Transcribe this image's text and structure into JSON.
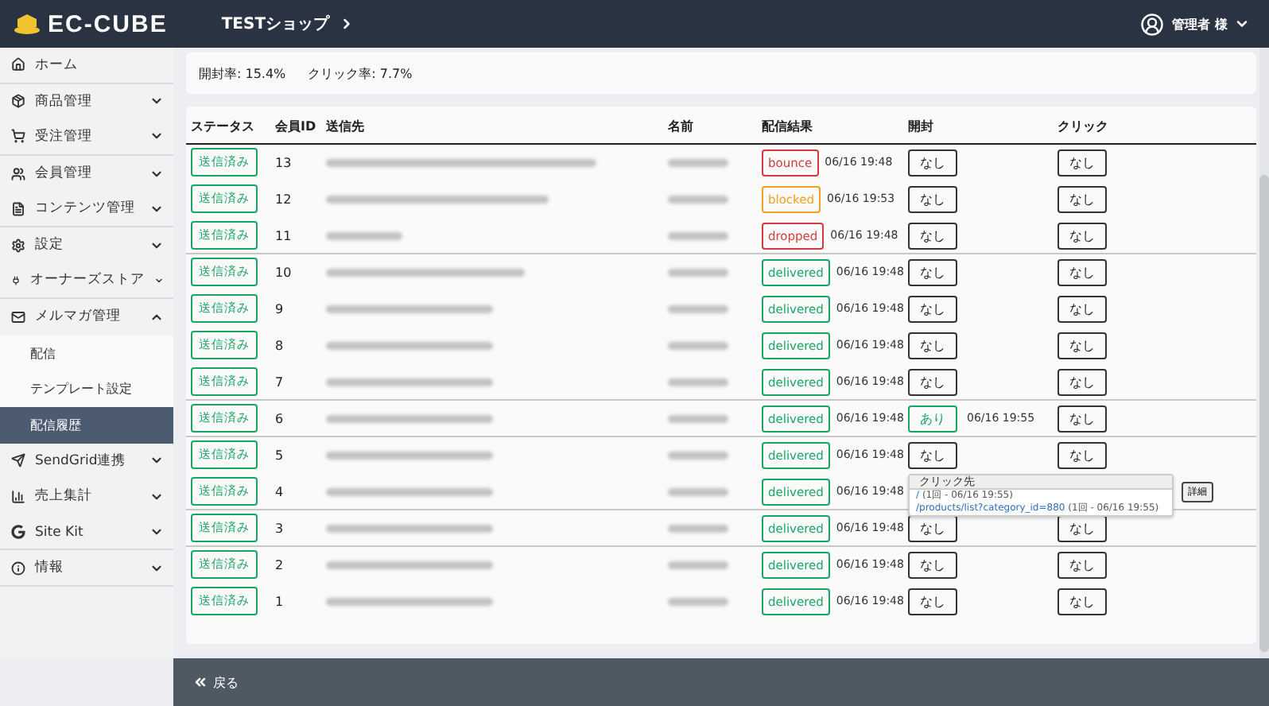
{
  "header": {
    "logo": "EC-CUBE",
    "shop": "TESTショップ",
    "user": "管理者 様"
  },
  "sidebar": {
    "items": [
      {
        "label": "ホーム",
        "expandable": false,
        "expanded": false
      },
      {
        "label": "商品管理",
        "expandable": true,
        "expanded": false
      },
      {
        "label": "受注管理",
        "expandable": true,
        "expanded": false
      },
      {
        "label": "会員管理",
        "expandable": true,
        "expanded": false
      },
      {
        "label": "コンテンツ管理",
        "expandable": true,
        "expanded": false
      },
      {
        "label": "設定",
        "expandable": true,
        "expanded": false
      },
      {
        "label": "オーナーズストア",
        "expandable": true,
        "expanded": false
      },
      {
        "label": "メルマガ管理",
        "expandable": true,
        "expanded": true,
        "children": [
          {
            "label": "配信",
            "selected": false
          },
          {
            "label": "テンプレート設定",
            "selected": false
          },
          {
            "label": "配信履歴",
            "selected": true
          }
        ]
      },
      {
        "label": "SendGrid連携",
        "expandable": true,
        "expanded": false
      },
      {
        "label": "売上集計",
        "expandable": true,
        "expanded": false
      },
      {
        "label": "Site Kit",
        "expandable": true,
        "expanded": false
      },
      {
        "label": "情報",
        "expandable": true,
        "expanded": false
      }
    ]
  },
  "stats": [
    "開封率: 15.4%",
    "クリック率: 7.7%"
  ],
  "table": {
    "columns": [
      "ステータス",
      "会員ID",
      "送信先",
      "名前",
      "配信結果",
      "開封",
      "クリック"
    ],
    "rows": [
      {
        "status": "送信済み",
        "id": "13",
        "result": {
          "label": "bounce",
          "color": "#d33a3a",
          "time": "06/16 19:48"
        },
        "open": {
          "label": "なし",
          "opened": false
        },
        "click": {
          "label": "なし"
        }
      },
      {
        "status": "送信済み",
        "id": "12",
        "result": {
          "label": "blocked",
          "color": "#f0a020",
          "time": "06/16 19:53"
        },
        "open": {
          "label": "なし",
          "opened": false
        },
        "click": {
          "label": "なし"
        }
      },
      {
        "status": "送信済み",
        "id": "11",
        "result": {
          "label": "dropped",
          "color": "#d33a3a",
          "time": "06/16 19:48"
        },
        "open": {
          "label": "なし",
          "opened": false
        },
        "click": {
          "label": "なし"
        }
      },
      {
        "status": "送信済み",
        "id": "10",
        "result": {
          "label": "delivered",
          "color": "#19a463",
          "time": "06/16 19:48"
        },
        "open": {
          "label": "なし",
          "opened": false
        },
        "click": {
          "label": "なし"
        }
      },
      {
        "status": "送信済み",
        "id": "9",
        "result": {
          "label": "delivered",
          "color": "#19a463",
          "time": "06/16 19:48"
        },
        "open": {
          "label": "なし",
          "opened": false
        },
        "click": {
          "label": "なし"
        }
      },
      {
        "status": "送信済み",
        "id": "8",
        "result": {
          "label": "delivered",
          "color": "#19a463",
          "time": "06/16 19:48"
        },
        "open": {
          "label": "なし",
          "opened": false
        },
        "click": {
          "label": "なし"
        }
      },
      {
        "status": "送信済み",
        "id": "7",
        "result": {
          "label": "delivered",
          "color": "#19a463",
          "time": "06/16 19:48"
        },
        "open": {
          "label": "なし",
          "opened": false
        },
        "click": {
          "label": "なし"
        }
      },
      {
        "status": "送信済み",
        "id": "6",
        "result": {
          "label": "delivered",
          "color": "#19a463",
          "time": "06/16 19:48"
        },
        "open": {
          "label": "あり",
          "opened": true,
          "time": "06/16 19:55"
        },
        "click": {
          "label": "なし"
        }
      },
      {
        "status": "送信済み",
        "id": "5",
        "result": {
          "label": "delivered",
          "color": "#19a463",
          "time": "06/16 19:48"
        },
        "open": {
          "label": "なし",
          "opened": false
        },
        "click": {
          "label": "なし"
        }
      },
      {
        "status": "送信済み",
        "id": "4",
        "result": {
          "label": "delivered",
          "color": "#19a463",
          "time": "06/16 19:48"
        },
        "popup": {
          "title": "クリック先",
          "links": [
            {
              "url": "/",
              "note": "(1回 - 06/16 19:55)"
            },
            {
              "url": "/products/list?category_id=880",
              "note": "(1回 - 06/16 19:55)"
            }
          ]
        },
        "click": {
          "detail": "詳細"
        }
      },
      {
        "status": "送信済み",
        "id": "3",
        "result": {
          "label": "delivered",
          "color": "#19a463",
          "time": "06/16 19:48"
        },
        "open": {
          "label": "なし",
          "opened": false
        },
        "click": {
          "label": "なし"
        }
      },
      {
        "status": "送信済み",
        "id": "2",
        "result": {
          "label": "delivered",
          "color": "#19a463",
          "time": "06/16 19:48"
        },
        "open": {
          "label": "なし",
          "opened": false
        },
        "click": {
          "label": "なし"
        }
      },
      {
        "status": "送信済み",
        "id": "1",
        "result": {
          "label": "delivered",
          "color": "#19a463",
          "time": "06/16 19:48"
        },
        "open": {
          "label": "なし",
          "opened": false
        },
        "click": {
          "label": "なし"
        }
      }
    ]
  },
  "footer": {
    "back": "戻る"
  }
}
